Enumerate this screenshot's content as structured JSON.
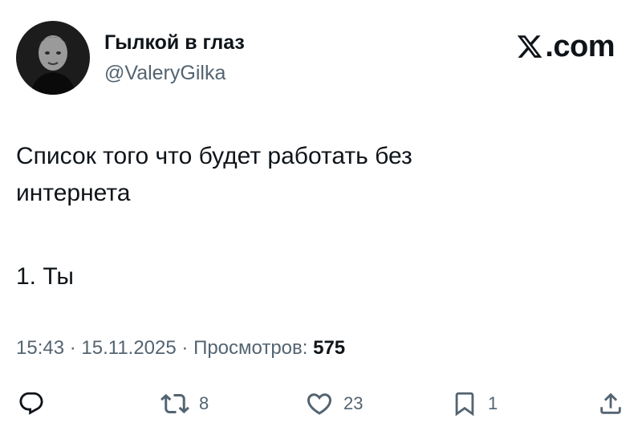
{
  "author": {
    "display_name": "Гылкой в глаз",
    "handle": "@ValeryGilka"
  },
  "brand": {
    "text": ".com"
  },
  "tweet": {
    "line1": "Список того что будет работать без",
    "line2": "интернета",
    "line3": "1. Ты"
  },
  "meta": {
    "time": "15:43",
    "separator": " · ",
    "date": "15.11.2025",
    "views_label": "Просмотров:",
    "views_count": "575"
  },
  "actions": {
    "reply_icon": "reply-icon",
    "retweet_icon": "retweet-icon",
    "retweet_count": "8",
    "like_icon": "heart-icon",
    "like_count": "23",
    "bookmark_icon": "bookmark-icon",
    "bookmark_count": "1",
    "share_icon": "share-icon"
  },
  "colors": {
    "text_primary": "#0f1419",
    "text_secondary": "#536471",
    "background": "#ffffff"
  }
}
